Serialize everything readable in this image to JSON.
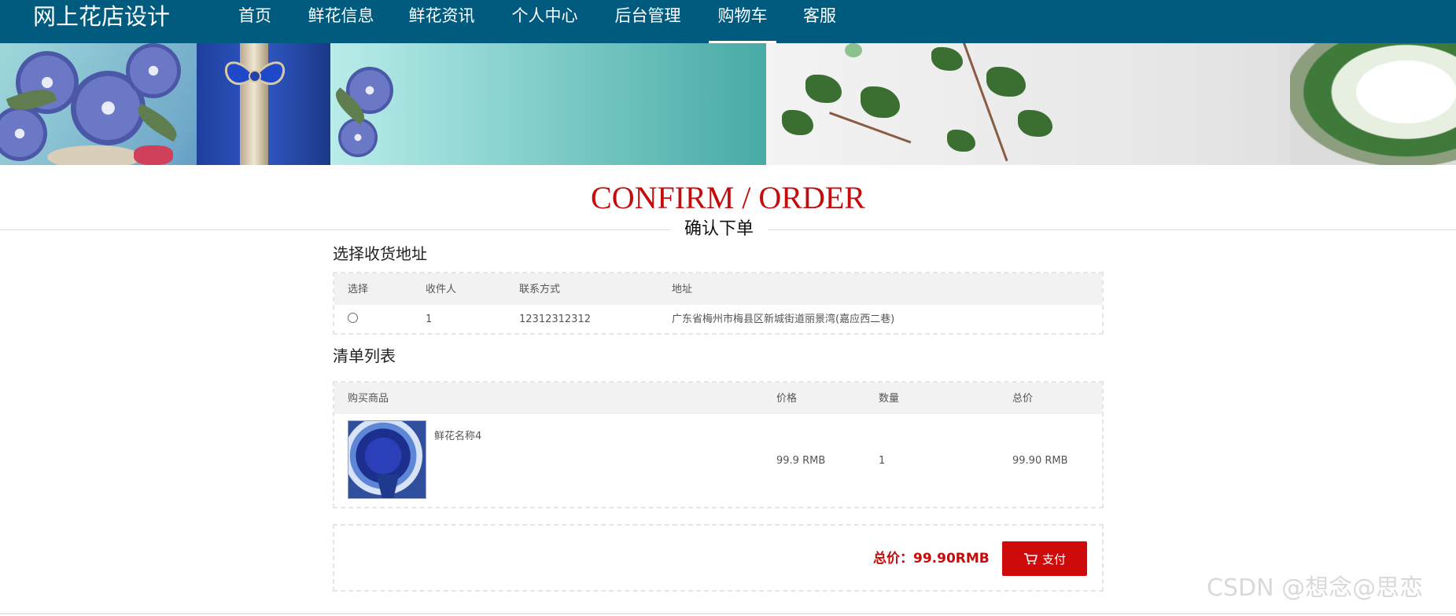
{
  "brand": "网上花店设计",
  "nav": [
    {
      "label": "首页"
    },
    {
      "label": "鲜花信息"
    },
    {
      "label": "鲜花资讯"
    },
    {
      "label": "个人中心"
    },
    {
      "label": "后台管理"
    },
    {
      "label": "购物车"
    },
    {
      "label": "客服"
    }
  ],
  "nav_active": "购物车",
  "heading": {
    "en": "CONFIRM / ORDER",
    "zh": "确认下单"
  },
  "address_section": {
    "label": "选择收货地址",
    "headers": [
      "选择",
      "收件人",
      "联系方式",
      "地址"
    ],
    "rows": [
      {
        "selected": false,
        "recipient": "1",
        "phone": "12312312312",
        "address": "广东省梅州市梅县区新城街道丽景湾(嘉应西二巷)"
      }
    ]
  },
  "order_section": {
    "label": "清单列表",
    "headers": [
      "购买商品",
      "价格",
      "数量",
      "总价"
    ],
    "items": [
      {
        "name": "鲜花名称4",
        "image": "blue-rose-bouquet",
        "price": "99.9 RMB",
        "quantity": "1",
        "subtotal": "99.90 RMB"
      }
    ]
  },
  "payment": {
    "total_label": "总价：99.90RMB",
    "pay_button": "支付",
    "pay_icon": "cart-icon"
  },
  "watermark": "CSDN @想念@思恋",
  "colors": {
    "nav_bg": "#005b7f",
    "accent_red": "#c40c0c",
    "button_red": "#cf0a0a",
    "table_header_bg": "#f2f2f2"
  }
}
